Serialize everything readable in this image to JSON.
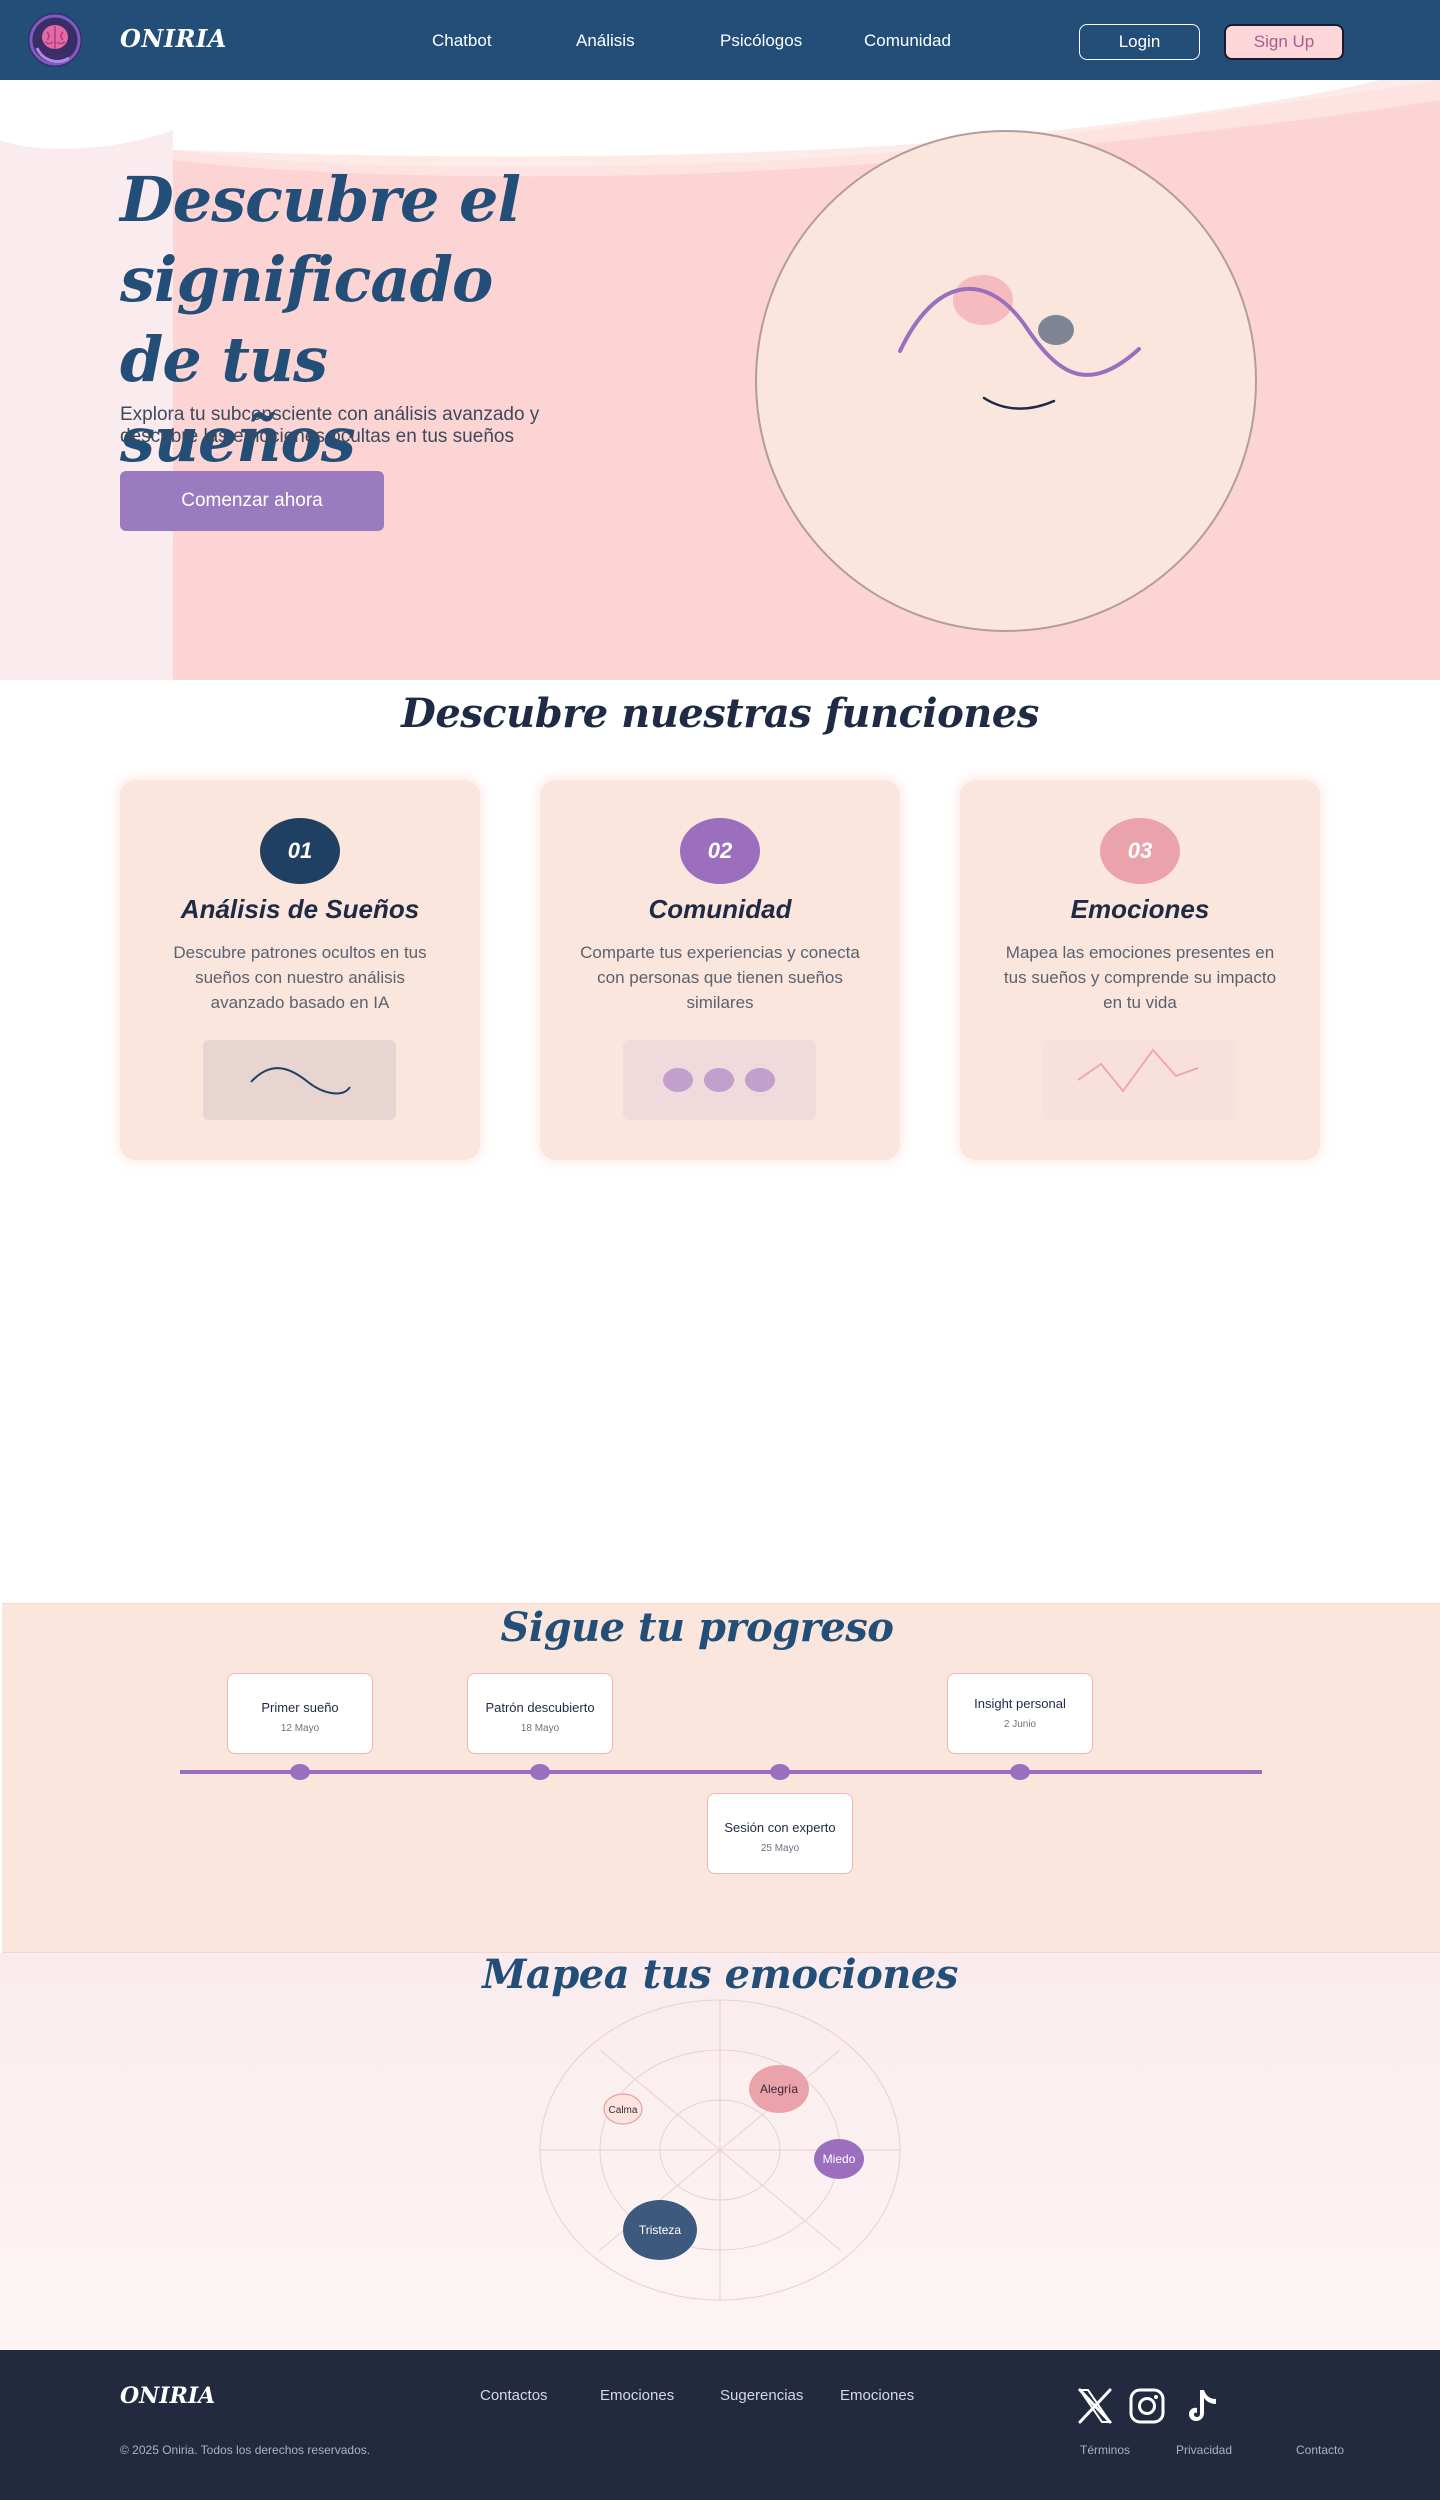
{
  "nav": {
    "brand": "ONIRIA",
    "links": [
      "Chatbot",
      "Análisis",
      "Psicólogos",
      "Comunidad"
    ],
    "login_label": "Login",
    "signup_label": "Sign Up"
  },
  "hero": {
    "title": "Descubre el significado de tus sueños",
    "subtitle": "Explora tu subconsciente con análisis avanzado y descubre las emociones ocultas en tus sueños",
    "cta_label": "Comenzar ahora"
  },
  "features": {
    "title": "Descubre nuestras funciones",
    "cards": [
      {
        "number": "01",
        "title": "Análisis de Sueños",
        "description": "Descubre patrones ocultos en tus sueños con nuestro análisis avanzado basado en IA",
        "badge_color": "#1f4062"
      },
      {
        "number": "02",
        "title": "Comunidad",
        "description": "Comparte tus experiencias y conecta con personas que tienen sueños similares",
        "badge_color": "#9b6fbe"
      },
      {
        "number": "03",
        "title": "Emociones",
        "description": "Mapea las emociones presentes en tus sueños y comprende su impacto en tu vida",
        "badge_color": "#eba3ab"
      }
    ]
  },
  "progress": {
    "title": "Sigue tu progreso",
    "milestones": [
      {
        "label": "Primer sueño",
        "date": "12 Mayo"
      },
      {
        "label": "Patrón descubierto",
        "date": "18 Mayo"
      },
      {
        "label": "Sesión con experto",
        "date": "25 Mayo"
      },
      {
        "label": "Insight personal",
        "date": "2 Junio"
      }
    ]
  },
  "emotions": {
    "title": "Mapea tus emociones",
    "items": [
      {
        "label": "Alegría",
        "color": "#eba3ab"
      },
      {
        "label": "Calma",
        "color": "#fde3dd"
      },
      {
        "label": "Miedo",
        "color": "#9b6fbe"
      },
      {
        "label": "Tristeza",
        "color": "#3d5a7e"
      }
    ]
  },
  "footer": {
    "brand": "ONIRIA",
    "links": [
      "Contactos",
      "Emociones",
      "Sugerencias",
      "Emociones"
    ],
    "copyright": "© 2025 Oniria. Todos los derechos reservados.",
    "social": [
      "x-icon",
      "instagram-icon",
      "tiktok-icon"
    ],
    "legal": [
      "Términos",
      "Privacidad",
      "Contacto"
    ]
  },
  "colors": {
    "primary": "#224e77",
    "accent": "#9b6fbe",
    "pink": "#fcd6d9",
    "peach": "#fae6dc",
    "footer": "#232a40"
  }
}
